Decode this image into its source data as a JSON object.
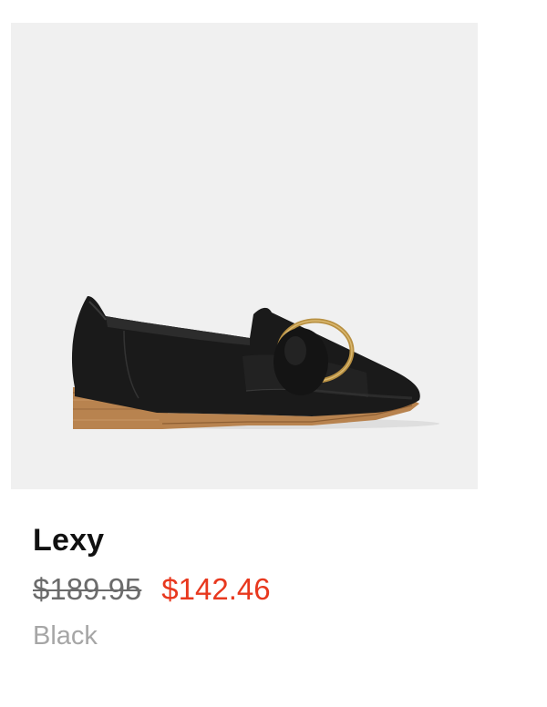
{
  "product": {
    "image_icon": "loafer-shoe-image",
    "name": "Lexy",
    "price_original": "$189.95",
    "price_sale": "$142.46",
    "color": "Black"
  },
  "colors": {
    "image_background": "#f0f0f0",
    "name": "#111111",
    "price_original": "#6b6b6b",
    "price_sale": "#e8381e",
    "color_text": "#a6a6a6"
  }
}
